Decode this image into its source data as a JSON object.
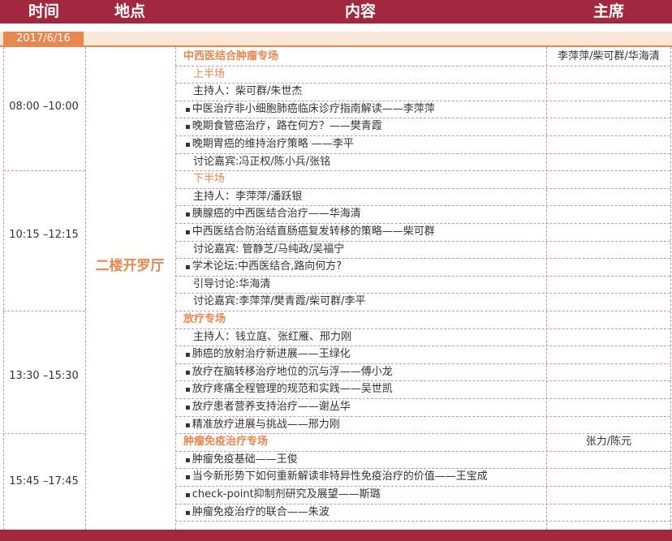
{
  "header": {
    "time": "时间",
    "place": "地点",
    "content": "内容",
    "chair": "主席"
  },
  "date": "2017/6/16",
  "room": "二楼开罗厅",
  "sessions": [
    {
      "time": "08:00 –10:00"
    },
    {
      "time": "10:15 –12:15"
    },
    {
      "time": "13:30 –15:30"
    },
    {
      "time": "15:45 –17:45"
    }
  ],
  "rows": [
    {
      "style": "sec",
      "text": "中西医结合肿瘤专场",
      "chair": "李萍萍/柴可群/华海清"
    },
    {
      "style": "sub",
      "text": "上半场"
    },
    {
      "style": "plain",
      "text": "主持人：柴可群/朱世杰"
    },
    {
      "style": "bul",
      "text": "中医治疗非小细胞肺癌临床诊疗指南解读——李萍萍"
    },
    {
      "style": "bul",
      "text": "晚期食管癌治疗，路在何方？——樊青霞"
    },
    {
      "style": "bul",
      "text": "晚期胃癌的维持治疗策略 ——李平"
    },
    {
      "style": "plain",
      "text": "讨论嘉宾:冯正权/陈小兵/张铭"
    },
    {
      "style": "sub",
      "text": "下半场"
    },
    {
      "style": "plain",
      "text": "主持人：李萍萍/潘跃银"
    },
    {
      "style": "bul",
      "text": "胰腺癌的中西医结合治疗——华海清"
    },
    {
      "style": "bul",
      "text": "中西医结合防治结直肠癌复发转移的策略——柴可群"
    },
    {
      "style": "plain",
      "text": "讨论嘉宾: 管静芝/马纯政/吴福宁"
    },
    {
      "style": "bul",
      "text": "学术论坛:中西医结合,路向何方?"
    },
    {
      "style": "plain",
      "text": "引导讨论:华海清"
    },
    {
      "style": "plain",
      "text": "讨论嘉宾:李萍萍/樊青霞/柴可群/李平"
    },
    {
      "style": "sec",
      "text": "放疗专场"
    },
    {
      "style": "plain",
      "text": "主持人：钱立庭、张红雁、邢力刚"
    },
    {
      "style": "bul",
      "text": "肺癌的放射治疗新进展——王绿化"
    },
    {
      "style": "bul",
      "text": "放疗在脑转移治疗地位的沉与浮——傅小龙"
    },
    {
      "style": "bul",
      "text": "放疗疼痛全程管理的规范和实践——吴世凯"
    },
    {
      "style": "bul",
      "text": "放疗患者营养支持治疗——谢丛华"
    },
    {
      "style": "bul",
      "text": "精准放疗进展与挑战——邢力刚"
    },
    {
      "style": "sec",
      "text": "肿瘤免疫治疗专场",
      "chair": "张力/陈元"
    },
    {
      "style": "bul",
      "text": "肿瘤免疫基础——王俊"
    },
    {
      "style": "bul",
      "text": "当今新形势下如何重新解读非特异性免疫治疗的价值——王宝成"
    },
    {
      "style": "bul",
      "text": "check-point抑制剂研究及展望——斯璐"
    },
    {
      "style": "bul",
      "text": "肿瘤免疫治疗的联合——朱波"
    }
  ]
}
